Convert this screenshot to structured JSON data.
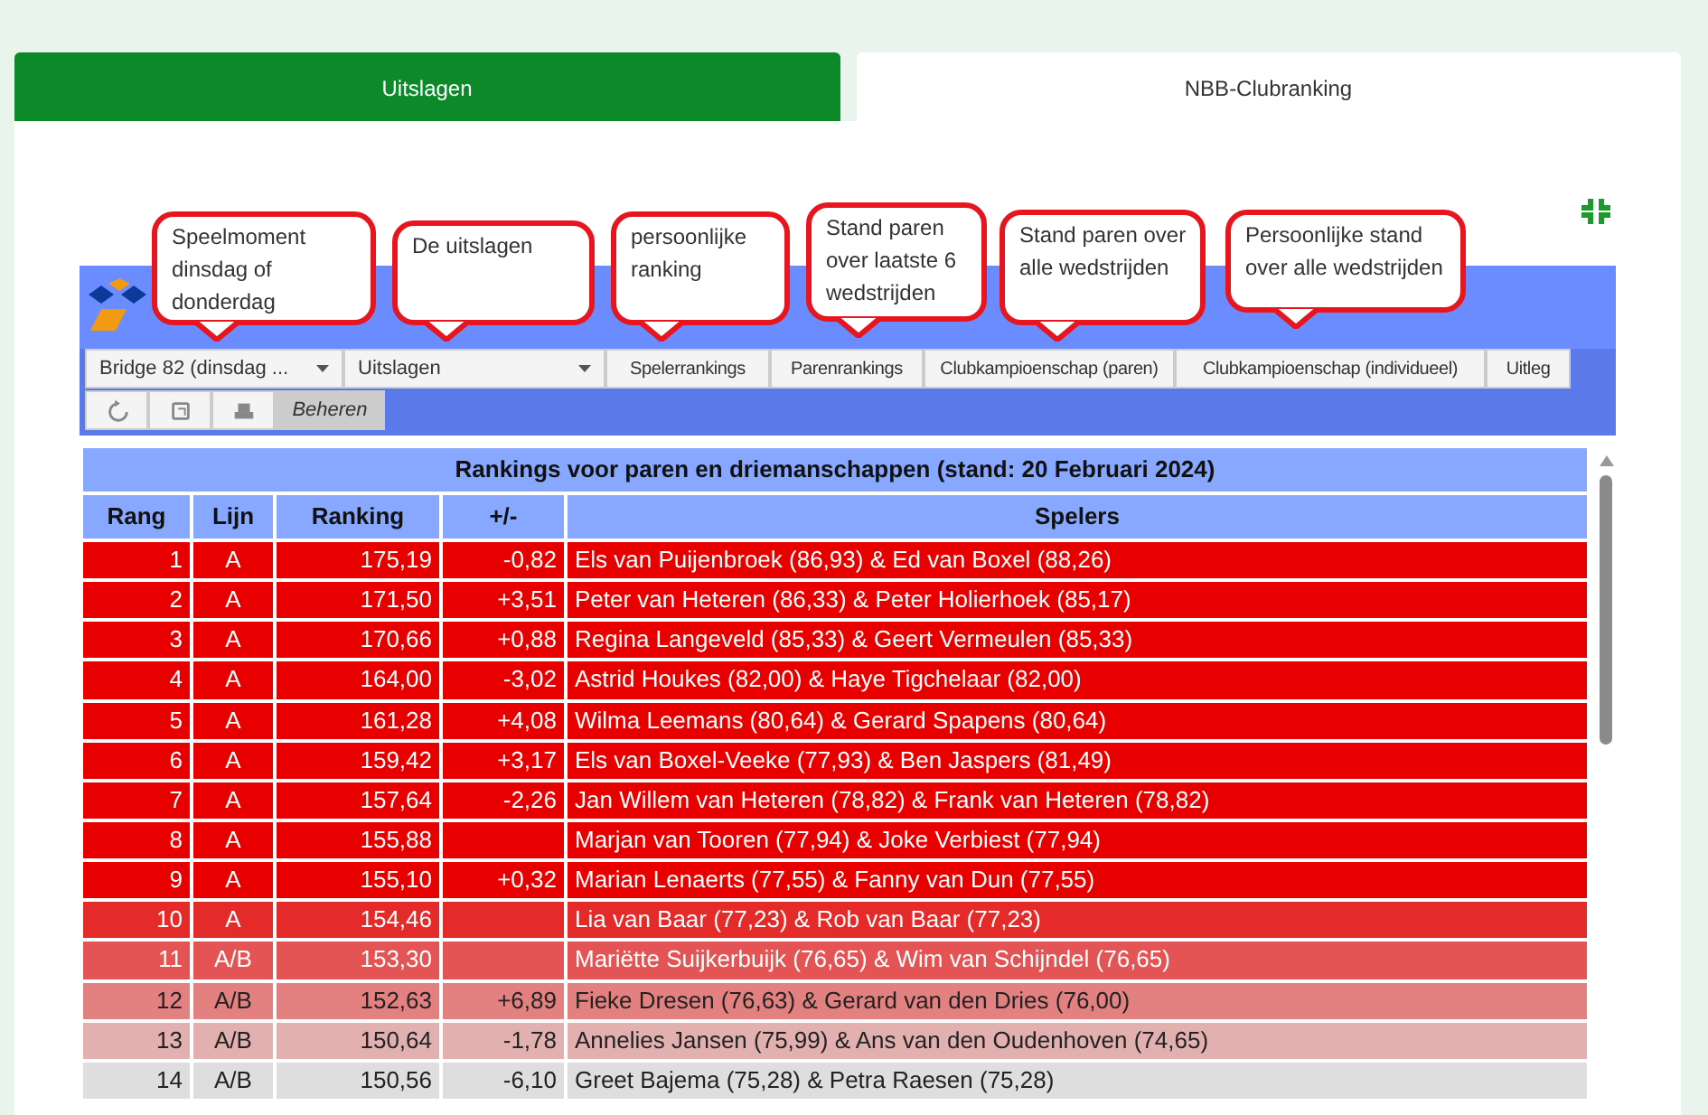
{
  "tabs": [
    {
      "label": "Uitslagen",
      "selected": true
    },
    {
      "label": "NBB-Clubranking",
      "selected": false
    }
  ],
  "callouts": [
    "Speelmoment dinsdag of donderdag",
    "De uitslagen",
    "persoonlijke ranking",
    "Stand paren over laatste 6 wedstrijden",
    "Stand paren over alle wedstrijden",
    "Persoonlijke stand over alle wedstrijden"
  ],
  "toolbar": {
    "dropdowns": [
      "Bridge 82 (dinsdag ...",
      "Uitslagen"
    ],
    "buttons": [
      "Spelerrankings",
      "Parenrankings",
      "Clubkampioenschap (paren)",
      "Clubkampioenschap (individueel)",
      "Uitleg"
    ],
    "tools": [
      {
        "kind": "refresh"
      },
      {
        "kind": "export"
      },
      {
        "kind": "print"
      }
    ],
    "admin": "Beheren"
  },
  "table": {
    "title": "Rankings voor paren en driemanschappen (stand: 20 Februari 2024)",
    "columns": [
      "Rang",
      "Lijn",
      "Ranking",
      "+/-",
      "Spelers"
    ],
    "rows": [
      {
        "cells": [
          "1",
          "A",
          "175,19",
          "-0,82",
          "Els van Puijenbroek (86,93) & Ed van Boxel (88,26)"
        ],
        "color": "#e80000"
      },
      {
        "cells": [
          "2",
          "A",
          "171,50",
          "+3,51",
          "Peter van Heteren (86,33) & Peter Holierhoek (85,17)"
        ],
        "color": "#e80000"
      },
      {
        "cells": [
          "3",
          "A",
          "170,66",
          "+0,88",
          "Regina Langeveld (85,33) & Geert Vermeulen (85,33)"
        ],
        "color": "#e80000"
      },
      {
        "cells": [
          "4",
          "A",
          "164,00",
          "-3,02",
          "Astrid Houkes (82,00) & Haye Tigchelaar (82,00)"
        ],
        "color": "#e80000"
      },
      {
        "cells": [
          "5",
          "A",
          "161,28",
          "+4,08",
          "Wilma Leemans (80,64) & Gerard Spapens (80,64)"
        ],
        "color": "#e80000"
      },
      {
        "cells": [
          "6",
          "A",
          "159,42",
          "+3,17",
          "Els van Boxel-Veeke (77,93) & Ben Jaspers (81,49)"
        ],
        "color": "#e80000"
      },
      {
        "cells": [
          "7",
          "A",
          "157,64",
          "-2,26",
          "Jan Willem van Heteren (78,82) & Frank van Heteren (78,82)"
        ],
        "color": "#e80000"
      },
      {
        "cells": [
          "8",
          "A",
          "155,88",
          null,
          "Marjan van Tooren (77,94) & Joke Verbiest (77,94)"
        ],
        "color": "#e80000"
      },
      {
        "cells": [
          "9",
          "A",
          "155,10",
          "+0,32",
          "Marian Lenaerts (77,55) & Fanny van Dun (77,55)"
        ],
        "color": "#e80000"
      },
      {
        "cells": [
          "10",
          "A",
          "154,46",
          null,
          "Lia van Baar (77,23) & Rob van Baar (77,23)"
        ],
        "color": "#e52a2a"
      },
      {
        "cells": [
          "11",
          "A/B",
          "153,30",
          null,
          "Mariëtte Suijkerbuijk (76,65) & Wim van Schijndel (76,65)"
        ],
        "color": "#e45454"
      },
      {
        "cells": [
          "12",
          "A/B",
          "152,63",
          "+6,89",
          "Fieke Dresen (76,63) & Gerard van den Dries (76,00)"
        ],
        "color": "#e38080"
      },
      {
        "cells": [
          "13",
          "A/B",
          "150,64",
          "-1,78",
          "Annelies Jansen (75,99) & Ans van den Oudenhoven (74,65)"
        ],
        "color": "#e3b0b0"
      },
      {
        "cells": [
          "14",
          "A/B",
          "150,56",
          "-6,10",
          "Greet Bajema (75,28) & Petra Raesen (75,28)"
        ],
        "color": "#dedede"
      }
    ]
  }
}
